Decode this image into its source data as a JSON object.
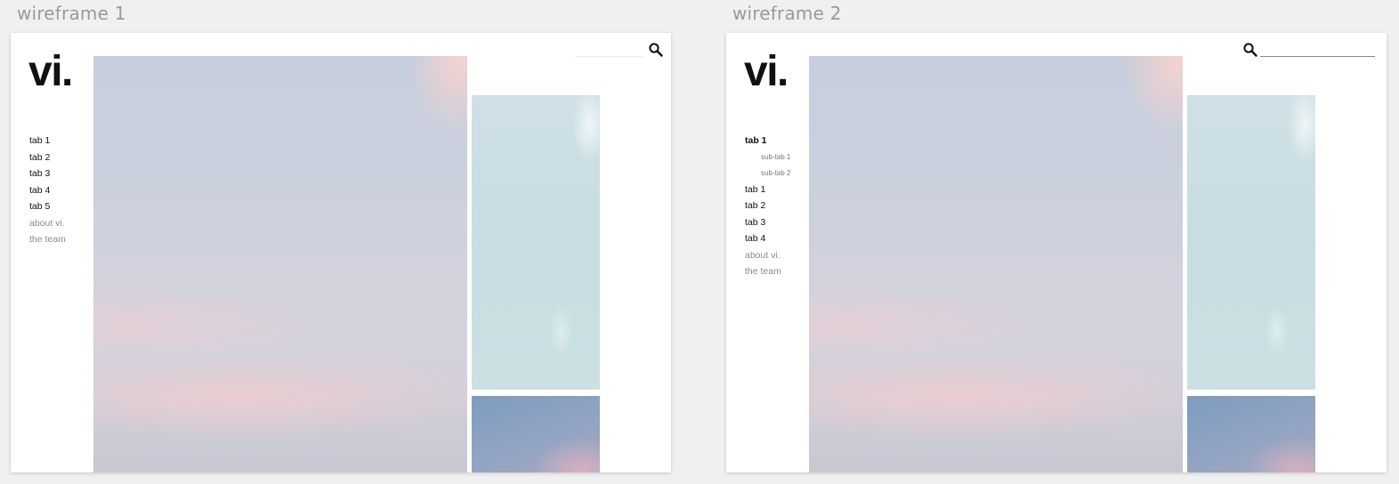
{
  "wireframes": [
    {
      "label": "wireframe 1",
      "logo": "vi.",
      "nav": [
        "tab 1",
        "tab 2",
        "tab 3",
        "tab 4",
        "tab 5",
        "about vi.",
        "the team"
      ]
    },
    {
      "label": "wireframe 2",
      "logo": "vi.",
      "nav": [
        "tab 1",
        "sub-tab 1",
        "sub-tab 2",
        "tab 1",
        "tab 2",
        "tab 3",
        "tab 4",
        "about vi.",
        "the team"
      ],
      "search_value": ""
    }
  ],
  "icons": {
    "search": "search-icon"
  },
  "colors": {
    "page_background": "#f0f0f0",
    "frame_background": "#ffffff",
    "label_text": "#9a9a9a",
    "primary_text": "#111111",
    "secondary_text": "#8a8a8a"
  }
}
